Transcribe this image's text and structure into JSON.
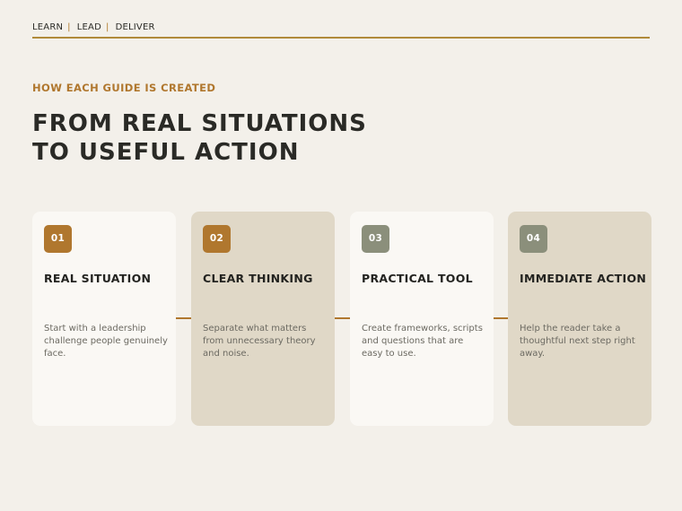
{
  "nav": {
    "items": [
      "LEARN",
      "LEAD",
      "DELIVER"
    ],
    "separator": "|"
  },
  "eyebrow": "HOW EACH GUIDE IS CREATED",
  "headline": {
    "line1": "FROM REAL SITUATIONS",
    "line2": "TO USEFUL ACTION"
  },
  "steps": [
    {
      "number": "01",
      "title": "REAL SITUATION",
      "description": "Start with a leadership challenge people genuinely face."
    },
    {
      "number": "02",
      "title": "CLEAR THINKING",
      "description": "Separate what matters from unnecessary theory and noise."
    },
    {
      "number": "03",
      "title": "PRACTICAL TOOL",
      "description": "Create frameworks, scripts and questions that are easy to use."
    },
    {
      "number": "04",
      "title": "IMMEDIATE ACTION",
      "description": "Help the reader take a thoughtful next step right away."
    }
  ],
  "colors": {
    "background": "#f3f0ea",
    "accent_gold": "#b0772e",
    "accent_sage": "#8b8f7b",
    "card_light": "#faf8f4",
    "card_dark": "#e0d8c7",
    "heading": "#2a2a26"
  }
}
